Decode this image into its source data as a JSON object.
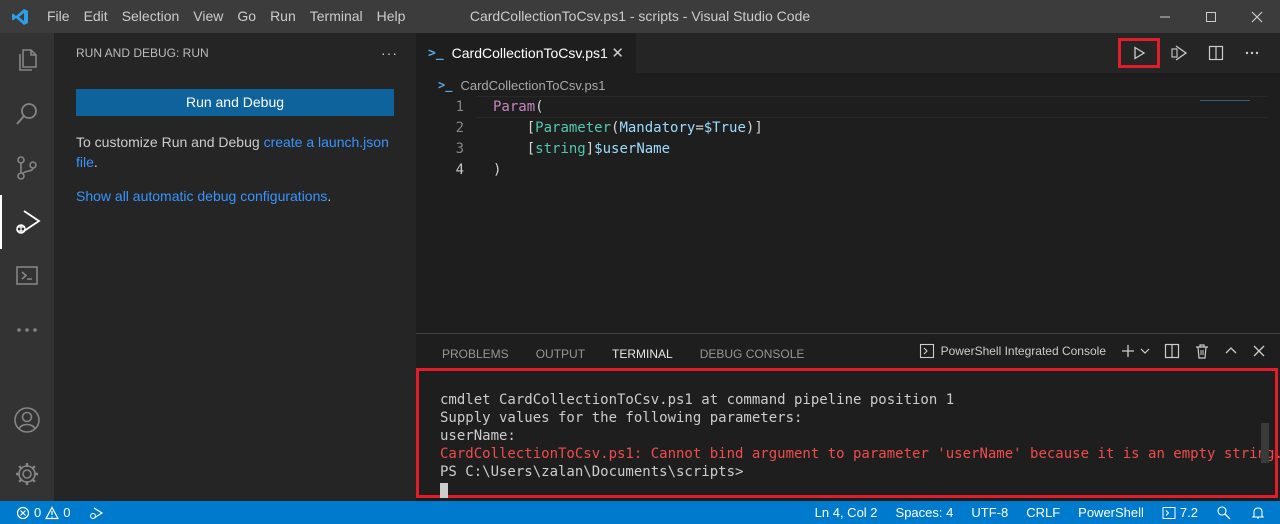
{
  "window": {
    "title": "CardCollectionToCsv.ps1 - scripts - Visual Studio Code"
  },
  "menu": [
    "File",
    "Edit",
    "Selection",
    "View",
    "Go",
    "Run",
    "Terminal",
    "Help"
  ],
  "sidebar": {
    "header": "RUN AND DEBUG: RUN",
    "run_button": "Run and Debug",
    "customize_text": "To customize Run and Debug ",
    "customize_link": "create a launch.json file",
    "customize_suffix": ".",
    "show_all_link": "Show all automatic debug configurations",
    "show_all_suffix": "."
  },
  "editor": {
    "tab_label": "CardCollectionToCsv.ps1",
    "breadcrumb": "CardCollectionToCsv.ps1",
    "code_lines": [
      {
        "n": "1",
        "parts": [
          [
            "kw",
            "Param"
          ],
          [
            "tok",
            "("
          ]
        ]
      },
      {
        "n": "2",
        "parts": [
          [
            "tok",
            "    ["
          ],
          [
            "fn",
            "Parameter"
          ],
          [
            "tok",
            "("
          ],
          [
            "var",
            "Mandatory"
          ],
          [
            "tok",
            "="
          ],
          [
            "var",
            "$True"
          ],
          [
            "tok",
            ")]"
          ]
        ]
      },
      {
        "n": "3",
        "parts": [
          [
            "tok",
            "    ["
          ],
          [
            "fn",
            "string"
          ],
          [
            "tok",
            "]"
          ],
          [
            "var",
            "$userName"
          ]
        ]
      },
      {
        "n": "4",
        "parts": [
          [
            "tok",
            ")"
          ]
        ]
      }
    ]
  },
  "panel": {
    "tabs": [
      "PROBLEMS",
      "OUTPUT",
      "TERMINAL",
      "DEBUG CONSOLE"
    ],
    "active_tab": "TERMINAL",
    "console_name": "PowerShell Integrated Console",
    "terminal_lines": [
      {
        "text": "cmdlet CardCollectionToCsv.ps1 at command pipeline position 1",
        "error": false
      },
      {
        "text": "Supply values for the following parameters:",
        "error": false
      },
      {
        "text": "userName:",
        "error": false
      },
      {
        "text": "CardCollectionToCsv.ps1: Cannot bind argument to parameter 'userName' because it is an empty string.",
        "error": true
      },
      {
        "text": "PS C:\\Users\\zalan\\Documents\\scripts>",
        "error": false
      }
    ]
  },
  "statusbar": {
    "errors": "0",
    "warnings": "0",
    "position": "Ln 4, Col 2",
    "spaces": "Spaces: 4",
    "encoding": "UTF-8",
    "eol": "CRLF",
    "language": "PowerShell",
    "ps_version": "7.2"
  },
  "colors": {
    "accent": "#007acc",
    "highlight_box": "#e21d2a",
    "error_text": "#f14c4c"
  }
}
